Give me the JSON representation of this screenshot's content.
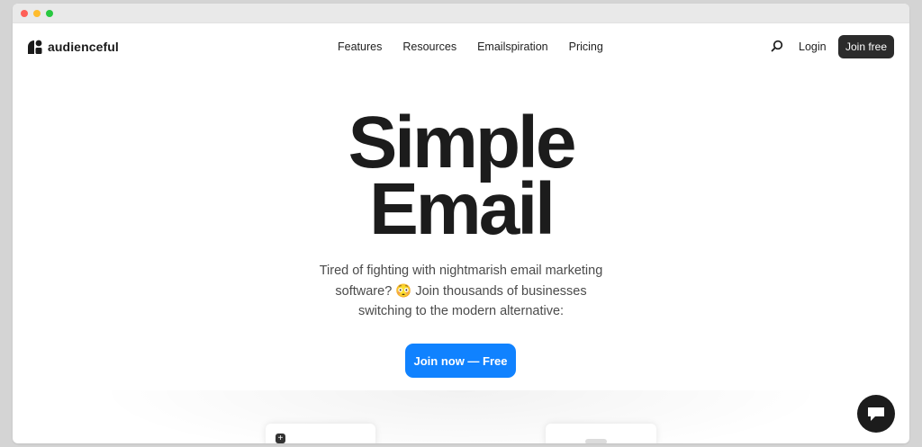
{
  "window": {
    "controls": [
      "close",
      "minimize",
      "maximize"
    ]
  },
  "nav": {
    "logo_text": "audienceful",
    "links": [
      {
        "label": "Features"
      },
      {
        "label": "Resources"
      },
      {
        "label": "Emailspiration"
      },
      {
        "label": "Pricing"
      }
    ],
    "search_icon": "search-icon",
    "login_label": "Login",
    "join_label": "Join free"
  },
  "hero": {
    "title_line1": "Simple",
    "title_line2": "Email",
    "subtitle": "Tired of fighting with nightmarish email marketing software? 😳 Join thousands of businesses switching to the modern alternative:",
    "cta_label": "Join now — Free"
  },
  "chat_widget": {
    "icon": "chat-bubble-icon"
  },
  "colors": {
    "accent": "#1082ff",
    "dark": "#2b2b2b",
    "text": "#1c1c1c"
  }
}
